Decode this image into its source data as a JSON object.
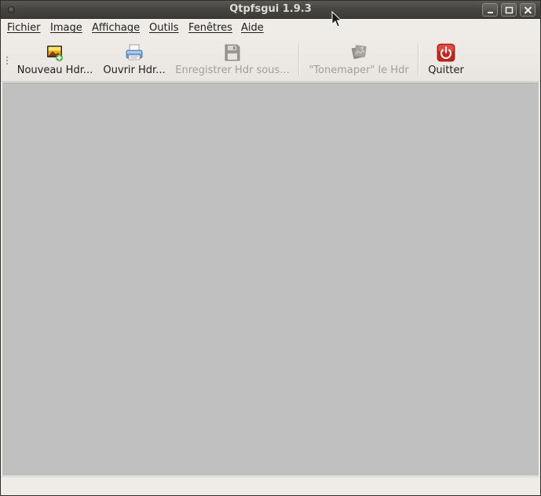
{
  "window": {
    "title": "Qtpfsgui 1.9.3",
    "controls": {
      "minimize_icon": "minimize-icon",
      "maximize_icon": "maximize-icon",
      "close_icon": "close-icon"
    }
  },
  "menubar": {
    "items": [
      {
        "mnemonic": "F",
        "rest": "ichier"
      },
      {
        "mnemonic": "I",
        "rest": "mage"
      },
      {
        "mnemonic": "A",
        "rest": "ffichage"
      },
      {
        "mnemonic": "O",
        "rest": "utils"
      },
      {
        "mnemonic": "F",
        "rest": "enêtres"
      },
      {
        "mnemonic": "A",
        "rest": "ide"
      }
    ]
  },
  "toolbar": {
    "buttons": [
      {
        "label": "Nouveau Hdr...",
        "icon": "new-hdr-icon",
        "enabled": true
      },
      {
        "label": "Ouvrir Hdr...",
        "icon": "open-hdr-icon",
        "enabled": true
      },
      {
        "label": "Enregistrer Hdr sous...",
        "icon": "save-icon",
        "enabled": false
      },
      {
        "label": "\"Tonemaper\" le Hdr",
        "icon": "tonemap-icon",
        "enabled": false
      },
      {
        "label": "Quitter",
        "icon": "quit-icon",
        "enabled": true
      }
    ]
  },
  "colors": {
    "titlebar": "#3c3b37",
    "title_text": "#dfdbd2",
    "window_bg": "#efebe7",
    "workspace_bg": "#c0c0c0",
    "disabled_text": "#a29f99",
    "quit_red": "#c7231b"
  }
}
